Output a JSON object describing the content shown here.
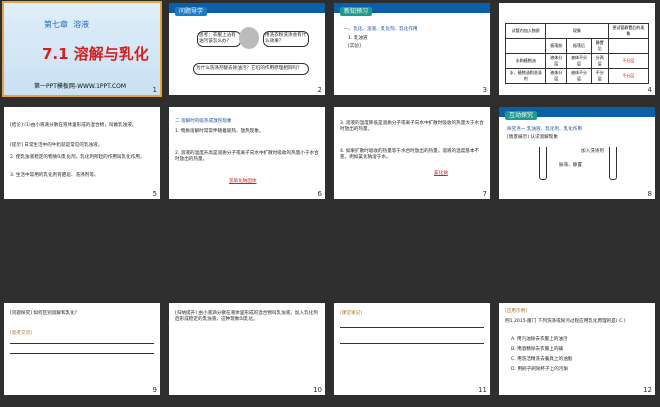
{
  "slides": [
    {
      "num": "1",
      "chapter": "第七章",
      "chapter_title": "溶液",
      "title": "7.1 溶解与乳化",
      "footer": "第一PPT模板网-WWW.1PPT.COM"
    },
    {
      "num": "2",
      "tag": "问题导学",
      "bubble_left": "思考：衣服上沾有油污该怎么办？",
      "bubble_right": "用洗衣粉洗涤会有什么效果？",
      "caption": "为什么洗涤剂能去除油污？它们的作用原理相同吗？"
    },
    {
      "num": "3",
      "tag": "新知预习",
      "heading": "一、乳化、溶液、乳化剂、乳化作用",
      "item1": "1. 乳浊液",
      "item2": "[实验]"
    },
    {
      "num": "4",
      "table_headers": [
        "试管内加入物质",
        "现象",
        "",
        "",
        "把试管静置后的现象"
      ],
      "table_sub": [
        "",
        "振荡前",
        "振荡后",
        "静置后",
        ""
      ],
      "table_rows": [
        [
          "水和植物油",
          "液体分层",
          "液体不分层",
          "分两层",
          "不分层"
        ],
        [
          "水、植物油和洗涤剂",
          "液体分层",
          "液体不分层",
          "不分层",
          "不分层"
        ]
      ]
    },
    {
      "num": "5",
      "text1": "[结论] (1)由小液滴分散在液体里形成的混合物，叫做乳浊液。",
      "blank1": "乳浊液",
      "text2": "[提示] 日常生活中的牛奶就是常见的乳浊液。",
      "text3": "2. 使乳浊液稳定的物质叫乳化剂，乳化剂所起的作用叫乳化作用。",
      "blank2": "乳化作用",
      "text4": "3. 生活中常用的乳化剂有肥皂、洗涤剂等。",
      "blank3": "肥皂、洗涤剂"
    },
    {
      "num": "6",
      "heading": "二 溶解时的吸热或放热现象",
      "text1": "1. 物质溶解时常常伴随着吸热、放热现象。",
      "text2": "2. 溶液的温度升高是溶质分子或离子向水中扩散时吸收的热量小于水合时放出的热量。",
      "blank": "氢氧化钠固体"
    },
    {
      "num": "7",
      "text1": "3. 溶液的温度降低是溶质分子或离子向水中扩散时吸收的热量大于水合时放出的热量。",
      "text2": "4. 如果扩散时吸收的热量等于水合时放出的热量，溶液的温度基本不变。例如氯化钠溶于水。",
      "blank": "氯化钠"
    },
    {
      "num": "8",
      "tag": "互动探究",
      "heading": "探究点一 乳浊液、乳化剂、乳化作用",
      "sub": "[情景展示] 认识溶解现象",
      "labels": [
        "加入洗涤剂",
        "振荡、静置"
      ]
    },
    {
      "num": "9",
      "q": "[问题探究] 如何区别溶解和乳化？",
      "a": "[思考交流]"
    },
    {
      "num": "10",
      "text": "[归纳提升] 由小液滴分散在液体里形成的混合物叫乳浊液，加入乳化剂后形成稳定的乳浊液，这种现象叫乳化。"
    },
    {
      "num": "11",
      "heading": "[课堂速记]"
    },
    {
      "num": "12",
      "tag": "[应用示例]",
      "q": "例1 2015·厦门 下列洗涤或除污过程应用乳化原理的是( C )",
      "options": [
        "A. 用汽油除去衣服上的油污",
        "B. 用酒精除去衣服上的碘",
        "C. 用洗洁精洗去餐具上的油脂",
        "D. 用刷子刷除杯子上的污垢"
      ]
    }
  ]
}
